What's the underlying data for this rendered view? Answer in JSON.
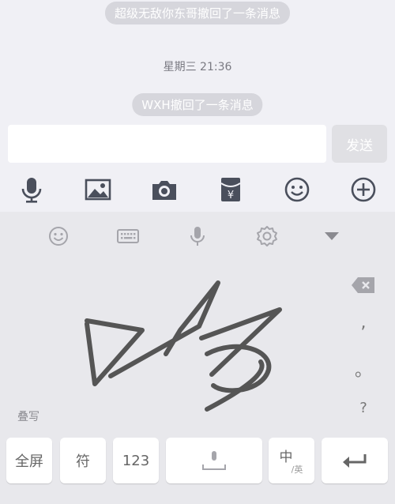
{
  "chat": {
    "recall_top": "超级无敌你东哥撤回了一条消息",
    "time": "星期三 21:36",
    "recall_self": "WXH撤回了一条消息"
  },
  "input": {
    "value": "",
    "send_label": "发送"
  },
  "toolbar": {
    "icons": [
      "microphone-icon",
      "image-icon",
      "camera-icon",
      "red-packet-icon",
      "emoji-icon",
      "plus-icon"
    ],
    "red_packet_symbol": "¥"
  },
  "keyboard": {
    "top_icons": [
      "emoji-icon",
      "keyboard-icon",
      "microphone-icon",
      "settings-icon",
      "collapse-icon"
    ],
    "side_keys": {
      "comma": ",",
      "period": "。",
      "question": "?"
    },
    "overlap_label": "叠写",
    "keys": {
      "fullscreen": "全屏",
      "symbol": "符",
      "numeric": "123",
      "chinese": "中",
      "english_sub": "/英"
    }
  },
  "colors": {
    "background": "#f0f0f5",
    "icon": "#4a4f5c",
    "keyboard_icon": "#a5a5ab",
    "ink": "#555555"
  }
}
